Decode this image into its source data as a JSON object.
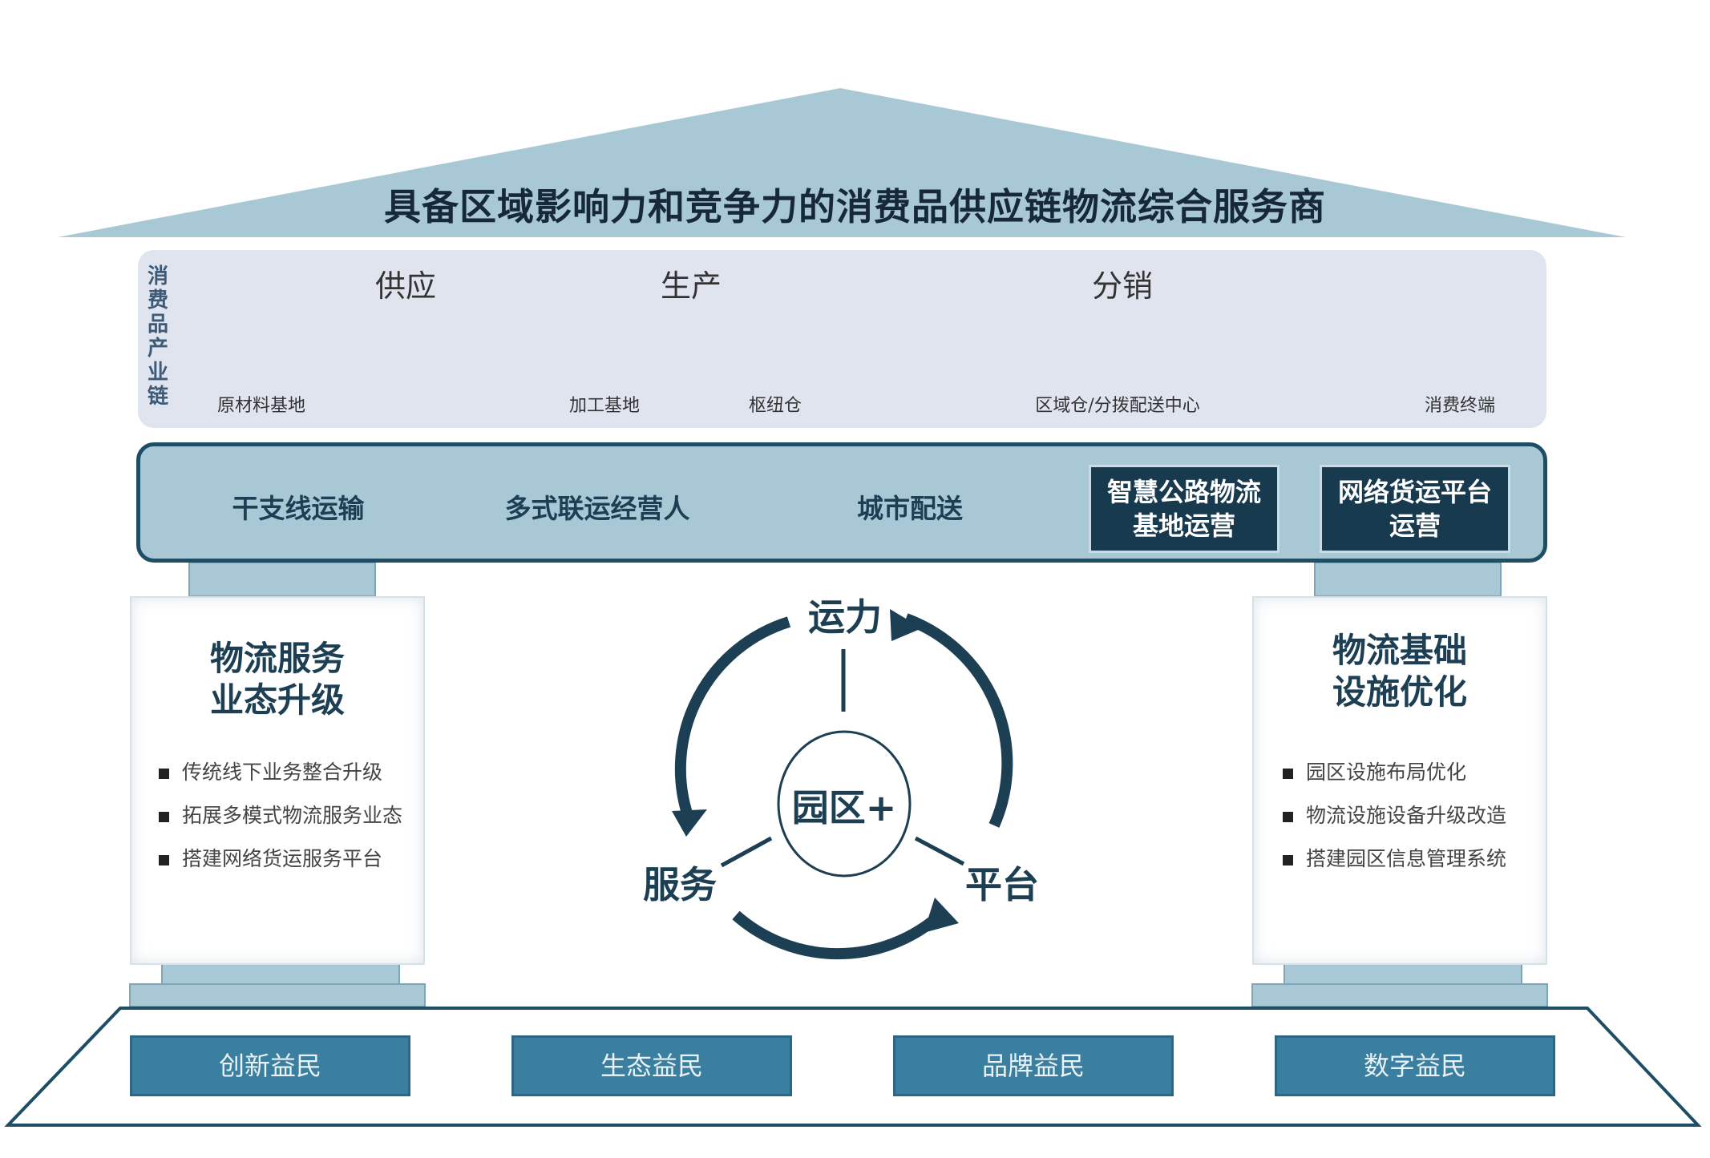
{
  "roof": {
    "title": "具备区域影响力和竞争力的消费品供应链物流综合服务商"
  },
  "chain": {
    "side_label": "消费品产业链",
    "segments": [
      "供应",
      "生产",
      "分销"
    ],
    "nodes": [
      "原材料基地",
      "加工基地",
      "枢纽仓",
      "区域仓/分拨配送中心",
      "消费终端"
    ]
  },
  "services": {
    "hexagons": [
      "干支线运输",
      "多式联运经营人",
      "城市配送"
    ],
    "boxes": [
      {
        "line1": "智慧公路物流",
        "line2": "基地运营"
      },
      {
        "line1": "网络货运平台",
        "line2": "运营"
      }
    ]
  },
  "left_pillar": {
    "title_line1": "物流服务",
    "title_line2": "业态升级",
    "items": [
      "传统线下业务整合升级",
      "拓展多模式物流服务业态",
      "搭建网络货运服务平台"
    ]
  },
  "right_pillar": {
    "title_line1": "物流基础",
    "title_line2": "设施优化",
    "items": [
      "园区设施布局优化",
      "物流设施设备升级改造",
      "搭建园区信息管理系统"
    ]
  },
  "cycle": {
    "top": "运力",
    "left": "服务",
    "right": "平台",
    "center": "园区+"
  },
  "base": {
    "items": [
      "创新益民",
      "生态益民",
      "品牌益民",
      "数字益民"
    ]
  },
  "colors": {
    "dark": "#173a4f",
    "mid": "#3a7fa0",
    "light": "#a8c8d6",
    "panel": "#dfe4ef"
  }
}
